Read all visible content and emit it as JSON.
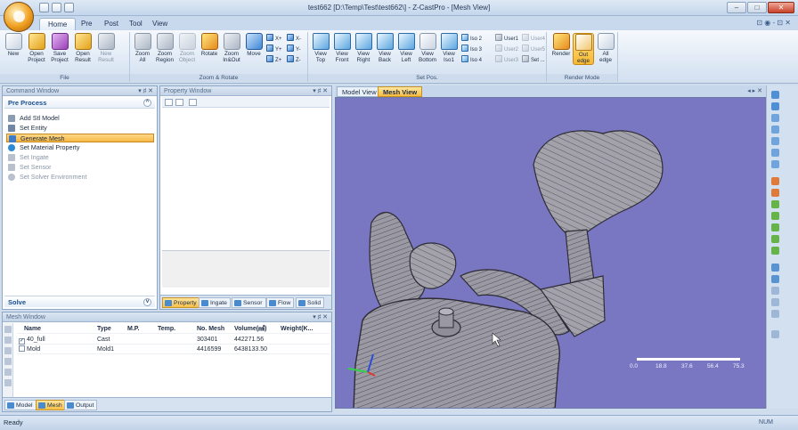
{
  "window": {
    "title": "test662 [D:\\Temp\\Test\\test662\\] - Z-CastPro - [Mesh View]",
    "controls": [
      "–",
      "□",
      "✕"
    ]
  },
  "ribbon_tabs": [
    {
      "label": "Home",
      "active": true
    },
    {
      "label": "Pre",
      "active": false
    },
    {
      "label": "Post",
      "active": false
    },
    {
      "label": "Tool",
      "active": false
    },
    {
      "label": "View",
      "active": false
    }
  ],
  "help_area": "⊡ ◉ - ⊡ ✕",
  "ribbon": {
    "groups": {
      "file": "File",
      "zoom_rotate": "Zoom & Rotate",
      "set_pos": "Set Pos.",
      "render_mode": "Render Mode"
    },
    "file_tools": [
      {
        "label": "New",
        "icon": "new-file-icon",
        "enabled": true
      },
      {
        "label": "Open\nProject",
        "icon": "open-project-icon",
        "enabled": true
      },
      {
        "label": "Save\nProject",
        "icon": "save-project-icon",
        "enabled": true
      },
      {
        "label": "Open\nResult",
        "icon": "open-result-icon",
        "enabled": true
      },
      {
        "label": "New\nResult",
        "icon": "new-result-icon",
        "enabled": false
      }
    ],
    "zoom_tools": [
      {
        "label": "Zoom\nAll",
        "icon": "zoom-all-icon",
        "enabled": true
      },
      {
        "label": "Zoom\nRegion",
        "icon": "zoom-region-icon",
        "enabled": true
      },
      {
        "label": "Zoom\nObject",
        "icon": "zoom-object-icon",
        "enabled": false
      },
      {
        "label": "Rotate",
        "icon": "rotate-icon",
        "enabled": true
      },
      {
        "label": "Zoom\nIn&Out",
        "icon": "zoom-in-out-icon",
        "enabled": true
      },
      {
        "label": "Move",
        "icon": "move-icon",
        "enabled": true
      }
    ],
    "axis_buttons": [
      "X+",
      "X-",
      "Y+",
      "Y-",
      "Z+",
      "Z-"
    ],
    "view_tools": [
      {
        "label": "View\nTop",
        "icon": "view-top-icon"
      },
      {
        "label": "View\nFront",
        "icon": "view-front-icon"
      },
      {
        "label": "View\nRight",
        "icon": "view-right-icon"
      },
      {
        "label": "View\nBack",
        "icon": "view-back-icon"
      },
      {
        "label": "View\nLeft",
        "icon": "view-left-icon"
      },
      {
        "label": "View\nBottom",
        "icon": "view-bottom-icon"
      },
      {
        "label": "View\nIso1",
        "icon": "view-iso1-icon"
      }
    ],
    "iso_buttons": [
      "Iso 2",
      "Iso 3",
      "Iso 4"
    ],
    "user_buttons": [
      {
        "label": "User1",
        "enabled": true
      },
      {
        "label": "User4",
        "enabled": false
      },
      {
        "label": "User2",
        "enabled": false
      },
      {
        "label": "User5",
        "enabled": false
      },
      {
        "label": "User3",
        "enabled": false
      },
      {
        "label": "Set ...",
        "enabled": true
      }
    ],
    "render_tools": [
      {
        "label": "Render",
        "icon": "render-icon",
        "active": false
      },
      {
        "label": "Out\nedge",
        "icon": "out-edge-icon",
        "active": true
      },
      {
        "label": "All\nedge",
        "icon": "all-edge-icon",
        "active": false
      }
    ]
  },
  "command_window": {
    "title": "Command Window",
    "controls": "▾ ♯ ✕",
    "section": "Pre Process",
    "items": [
      {
        "label": "Add Stl Model",
        "enabled": true,
        "selected": false,
        "icon": "stl-model-icon"
      },
      {
        "label": "Set Entity",
        "enabled": true,
        "selected": false,
        "icon": "entity-icon"
      },
      {
        "label": "Generate Mesh",
        "enabled": true,
        "selected": true,
        "icon": "mesh-icon"
      },
      {
        "label": "Set Material Property",
        "enabled": true,
        "selected": false,
        "icon": "material-icon"
      },
      {
        "label": "Set Ingate",
        "enabled": false,
        "selected": false,
        "icon": "ingate-icon"
      },
      {
        "label": "Set Sensor",
        "enabled": false,
        "selected": false,
        "icon": "sensor-icon"
      },
      {
        "label": "Set Solver Environment",
        "enabled": false,
        "selected": false,
        "icon": "solver-icon"
      }
    ],
    "solve_section": "Solve"
  },
  "property_window": {
    "title": "Property Window",
    "controls": "▾ ♯ ✕",
    "tabs": [
      {
        "label": "Property",
        "active": true
      },
      {
        "label": "Ingate",
        "active": false
      },
      {
        "label": "Sensor",
        "active": false
      },
      {
        "label": "Flow",
        "active": false
      },
      {
        "label": "Solid",
        "active": false
      }
    ]
  },
  "mesh_window": {
    "title": "Mesh Window",
    "controls": "▾ ♯ ✕",
    "columns": [
      "Name",
      "Type",
      "M.P.",
      "Temp.",
      "No. Mesh",
      "Volume(㎣)",
      "Weight(K..."
    ],
    "rows": [
      {
        "checked": true,
        "name": "40_full",
        "type": "Cast",
        "mp": "",
        "temp": "",
        "no_mesh": "303401",
        "volume": "442271.56",
        "weight": ""
      },
      {
        "checked": false,
        "name": "Mold",
        "type": "Mold1",
        "mp": "",
        "temp": "",
        "no_mesh": "4416599",
        "volume": "6438133.50",
        "weight": ""
      }
    ],
    "tabs": [
      {
        "label": "Model",
        "active": false
      },
      {
        "label": "Mesh",
        "active": true
      },
      {
        "label": "Output",
        "active": false
      }
    ]
  },
  "viewport": {
    "tabs": [
      {
        "label": "Model View",
        "active": false
      },
      {
        "label": "Mesh View",
        "active": true
      }
    ],
    "nav_arrows": "◂ ▸ ✕",
    "background": "#7a77c2",
    "scale_labels": [
      "0.0",
      "18.8",
      "37.6",
      "56.4",
      "75.3"
    ]
  },
  "status": {
    "text": "Ready",
    "num": "NUM"
  },
  "colors": {
    "accent": "#f6b744",
    "viewport_bg": "#7a77c2",
    "model_fill": "#9d9ca6"
  }
}
